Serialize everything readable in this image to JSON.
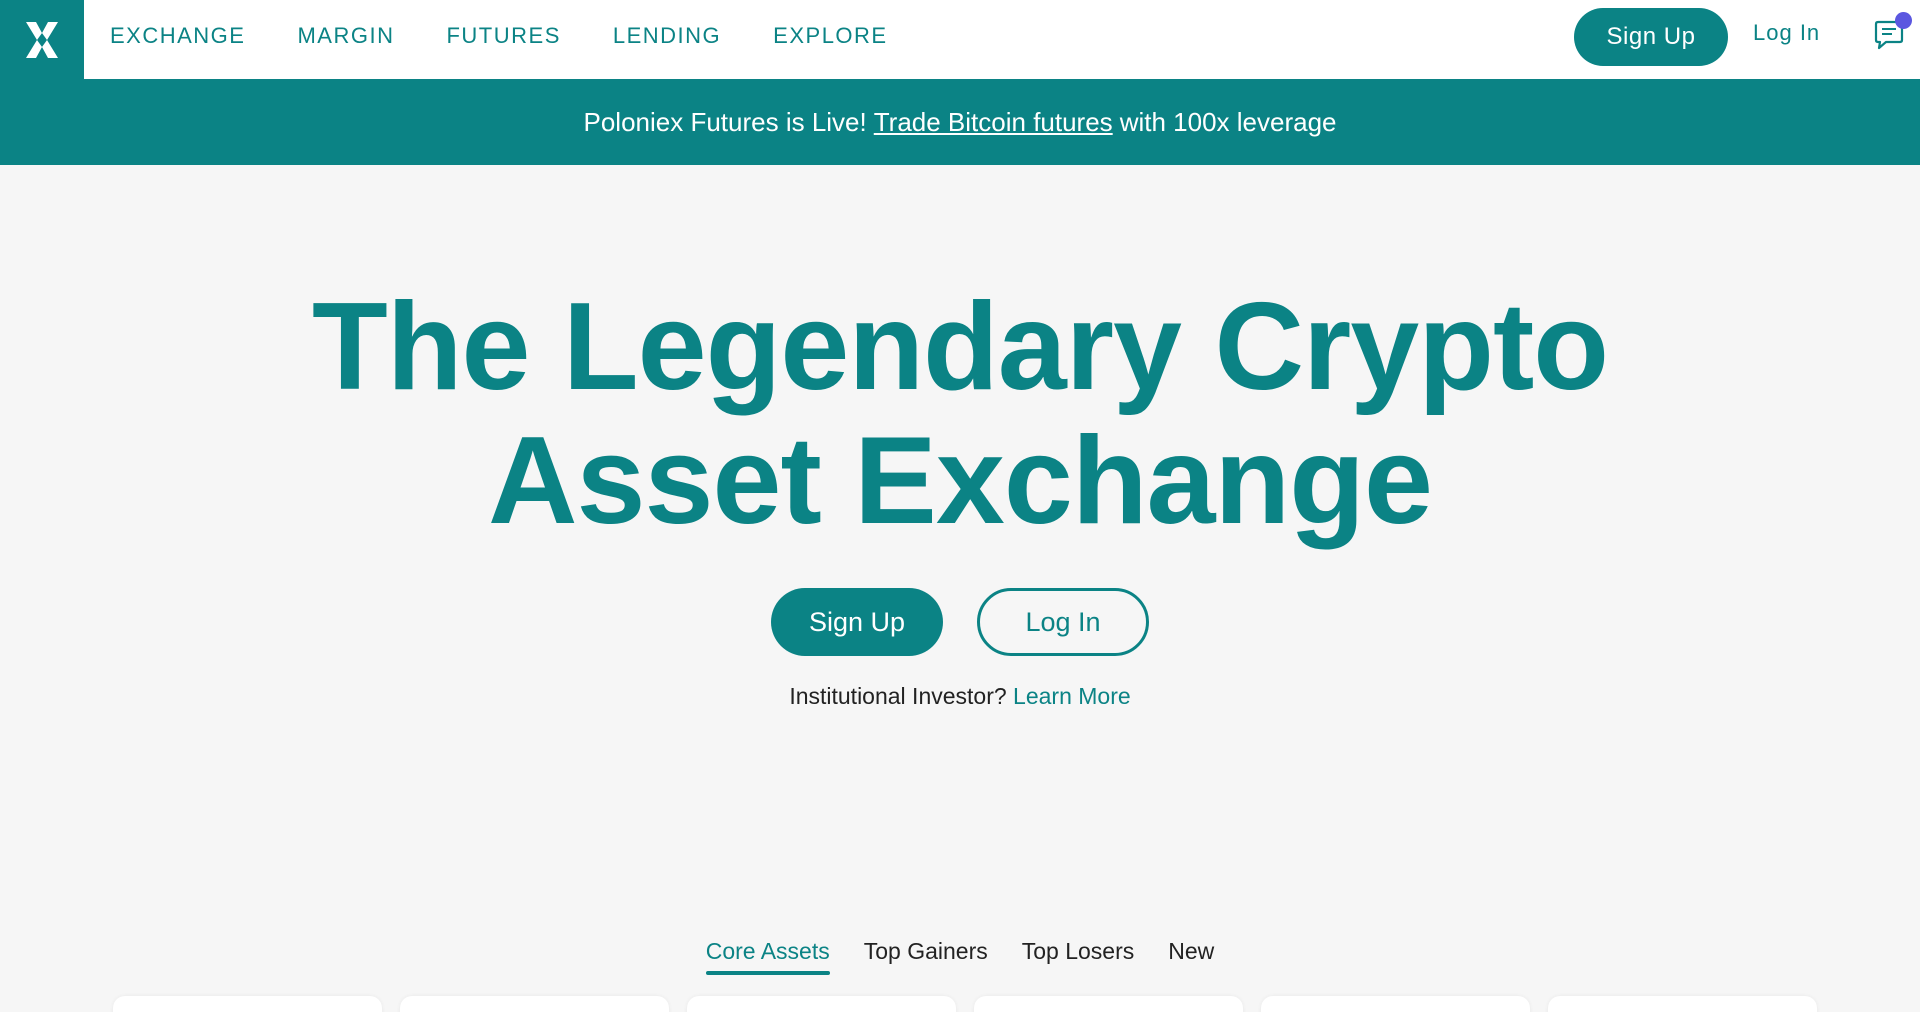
{
  "nav": {
    "items": [
      "EXCHANGE",
      "MARGIN",
      "FUTURES",
      "LENDING",
      "EXPLORE"
    ],
    "signup_label": "Sign Up",
    "login_label": "Log In"
  },
  "banner": {
    "prefix": "Poloniex Futures is Live!",
    "link": "Trade Bitcoin futures",
    "suffix": "with 100x leverage"
  },
  "hero": {
    "title_line1": "The Legendary Crypto",
    "title_line2": "Asset Exchange",
    "signup_label": "Sign Up",
    "login_label": "Log In",
    "institutional_text": "Institutional Investor?",
    "learn_more": "Learn More"
  },
  "tabs": [
    "Core Assets",
    "Top Gainers",
    "Top Losers",
    "New"
  ],
  "colors": {
    "brand": "#0b8385",
    "notification": "#5b57e0"
  },
  "icons": {
    "logo": "poloniex-logo-icon",
    "chat": "chat-icon"
  }
}
